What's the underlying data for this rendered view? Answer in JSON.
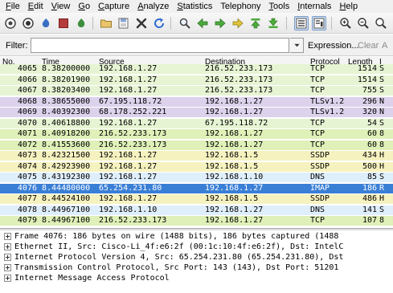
{
  "menu": [
    {
      "mnemonic": "F",
      "rest": "ile"
    },
    {
      "mnemonic": "E",
      "rest": "dit"
    },
    {
      "mnemonic": "V",
      "rest": "iew"
    },
    {
      "mnemonic": "G",
      "rest": "o"
    },
    {
      "mnemonic": "C",
      "rest": "apture"
    },
    {
      "mnemonic": "A",
      "rest": "nalyze"
    },
    {
      "mnemonic": "S",
      "rest": "tatistics"
    },
    {
      "mnemonic": "",
      "rest": "Telephony"
    },
    {
      "mnemonic": "T",
      "rest": "ools"
    },
    {
      "mnemonic": "I",
      "rest": "nternals"
    },
    {
      "mnemonic": "H",
      "rest": "elp"
    }
  ],
  "filter": {
    "label": "Filter:",
    "value": "",
    "expression_label": "Expression...",
    "clear_label": "Clear",
    "apply_label": "A"
  },
  "columns": {
    "no": "No.",
    "time": "Time",
    "source": "Source",
    "destination": "Destination",
    "protocol": "Protocol",
    "length": "Length",
    "info": "I"
  },
  "packets": [
    {
      "no": "4065",
      "time": "8.38200000",
      "src": "192.168.1.27",
      "dst": "216.52.233.173",
      "proto": "TCP",
      "len": "1514",
      "info": "S",
      "bg": "#e6f4d3",
      "fg": "#000000"
    },
    {
      "no": "4066",
      "time": "8.38201900",
      "src": "192.168.1.27",
      "dst": "216.52.233.173",
      "proto": "TCP",
      "len": "1514",
      "info": "S",
      "bg": "#e6f4d3",
      "fg": "#000000"
    },
    {
      "no": "4067",
      "time": "8.38203400",
      "src": "192.168.1.27",
      "dst": "216.52.233.173",
      "proto": "TCP",
      "len": "755",
      "info": "S",
      "bg": "#e6f4d3",
      "fg": "#000000"
    },
    {
      "no": "4068",
      "time": "8.38655000",
      "src": "67.195.118.72",
      "dst": "192.168.1.27",
      "proto": "TLSv1.2",
      "len": "296",
      "info": "N",
      "bg": "#dcd2ec",
      "fg": "#000000"
    },
    {
      "no": "4069",
      "time": "8.40392300",
      "src": "68.178.252.221",
      "dst": "192.168.1.27",
      "proto": "TLSv1.2",
      "len": "320",
      "info": "N",
      "bg": "#dcd2ec",
      "fg": "#000000"
    },
    {
      "no": "4070",
      "time": "8.40618800",
      "src": "192.168.1.27",
      "dst": "67.195.118.72",
      "proto": "TCP",
      "len": "54",
      "info": "S",
      "bg": "#e6f4d3",
      "fg": "#000000"
    },
    {
      "no": "4071",
      "time": "8.40918200",
      "src": "216.52.233.173",
      "dst": "192.168.1.27",
      "proto": "TCP",
      "len": "60",
      "info": "8",
      "bg": "#dff0b8",
      "fg": "#000000"
    },
    {
      "no": "4072",
      "time": "8.41553600",
      "src": "216.52.233.173",
      "dst": "192.168.1.27",
      "proto": "TCP",
      "len": "60",
      "info": "8",
      "bg": "#dff0b8",
      "fg": "#000000"
    },
    {
      "no": "4073",
      "time": "8.42321500",
      "src": "192.168.1.27",
      "dst": "192.168.1.5",
      "proto": "SSDP",
      "len": "434",
      "info": "H",
      "bg": "#f6f2c0",
      "fg": "#000000"
    },
    {
      "no": "4074",
      "time": "8.42923900",
      "src": "192.168.1.27",
      "dst": "192.168.1.5",
      "proto": "SSDP",
      "len": "500",
      "info": "H",
      "bg": "#f6f2c0",
      "fg": "#000000"
    },
    {
      "no": "4075",
      "time": "8.43192300",
      "src": "192.168.1.27",
      "dst": "192.168.1.10",
      "proto": "DNS",
      "len": "85",
      "info": "S",
      "bg": "#dfeefb",
      "fg": "#000000"
    },
    {
      "no": "4076",
      "time": "8.44480000",
      "src": "65.254.231.80",
      "dst": "192.168.1.27",
      "proto": "IMAP",
      "len": "186",
      "info": "R",
      "bg": "#3a7fd6",
      "fg": "#ffffff"
    },
    {
      "no": "4077",
      "time": "8.44524100",
      "src": "192.168.1.27",
      "dst": "192.168.1.5",
      "proto": "SSDP",
      "len": "486",
      "info": "H",
      "bg": "#f6f2c0",
      "fg": "#000000"
    },
    {
      "no": "4078",
      "time": "8.44967100",
      "src": "192.168.1.10",
      "dst": "192.168.1.27",
      "proto": "DNS",
      "len": "141",
      "info": "S",
      "bg": "#dfeefb",
      "fg": "#000000"
    },
    {
      "no": "4079",
      "time": "8.44967100",
      "src": "216.52.233.173",
      "dst": "192.168.1.27",
      "proto": "TCP",
      "len": "107",
      "info": "8",
      "bg": "#dff0b8",
      "fg": "#000000"
    }
  ],
  "details": [
    "Frame 4076: 186 bytes on wire (1488 bits), 186 bytes captured (1488",
    "Ethernet II, Src: Cisco-Li_4f:e6:2f (00:1c:10:4f:e6:2f), Dst: IntelC",
    "Internet Protocol Version 4, Src: 65.254.231.80 (65.254.231.80), Dst",
    "Transmission Control Protocol, Src Port: 143 (143), Dst Port: 51201",
    "Internet Message Access Protocol"
  ]
}
